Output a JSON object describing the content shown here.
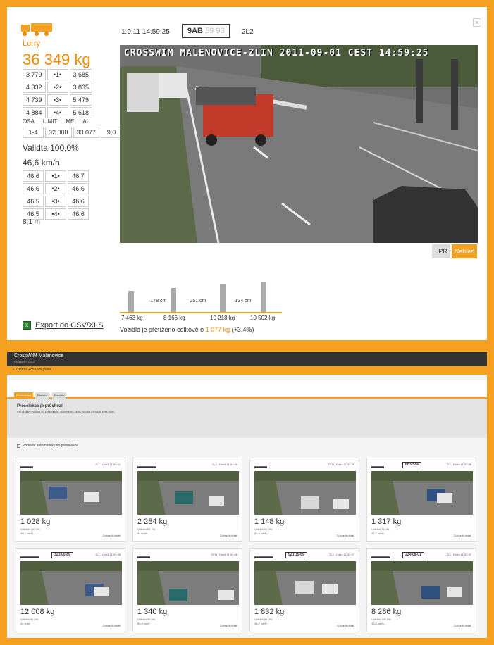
{
  "top": {
    "vehicle_label": "Lorry",
    "total_weight": "36 349 kg",
    "axle_weights": [
      {
        "left": "3 779",
        "axle": "•1•",
        "right": "3 685"
      },
      {
        "left": "4 332",
        "axle": "•2•",
        "right": "3 835"
      },
      {
        "left": "4 739",
        "axle": "•3•",
        "right": "5 479"
      },
      {
        "left": "4 884",
        "axle": "•4•",
        "right": "5 618"
      }
    ],
    "limit_headers": [
      "OSA",
      "LIMIT",
      "ME",
      "AL"
    ],
    "limit_row": [
      "1-4",
      "32 000",
      "33 077",
      "9,0"
    ],
    "validity": "Validta 100,0%",
    "speed": "46,6 km/h",
    "axle_speeds": [
      {
        "left": "46,6",
        "axle": "•1•",
        "right": "46,7"
      },
      {
        "left": "46,6",
        "axle": "•2•",
        "right": "46,6"
      },
      {
        "left": "46,5",
        "axle": "•3•",
        "right": "46,6"
      },
      {
        "left": "46,5",
        "axle": "•4•",
        "right": "46,6"
      }
    ],
    "length": "8,1 m",
    "export_label": "Export do CSV/XLS",
    "timestamp": "1.9.11 14:59:25",
    "plate_visible": "9AB",
    "plate_blurred": "59 93",
    "lane": "2L2",
    "close_label": "×",
    "camera_overlay": "CROSSWIM MALENOVICE-ZLIN   2011-09-01 CEST 14:59:25",
    "btn_lpr": "LPR",
    "btn_nahled": "Náhled",
    "axle_gaps": [
      "178 cm",
      "251 cm",
      "134 cm"
    ],
    "group_weights": [
      "7 463 kg",
      "8 166 kg",
      "10 218 kg",
      "10 502 kg"
    ],
    "bar_levels": [
      0.6,
      0.68,
      0.8,
      0.86
    ],
    "overload_prefix": "Vozidlo je přetíženo celkově o",
    "overload_value": "1 077 kg",
    "overload_pct": "(+3,4%)"
  },
  "bottom": {
    "app_title": "CrossWIM Malenovice",
    "app_subtitle": "CrossWIM 1.0.0",
    "back_label": "« Zpět na kontrolní panel",
    "tabs": [
      "Presedekce",
      "Přehled",
      "Pravidla"
    ],
    "info_title": "Preselekce je průchozí",
    "info_text": "Pro přidání vozidla do preselekce, klikněte na kartu vozidla (dvojklik přes níže).",
    "auto_checkbox": "Přidávat automaticky do preselekce",
    "detail_label": "Zobrazit detail",
    "cards": [
      {
        "icon": "▬▬",
        "plate": "",
        "meta": "2L1 | Dnes 11:04:41",
        "weight": "1 028 kg",
        "validity": "Validita 100,0%",
        "speed": "46,7 km/h"
      },
      {
        "icon": "▬▬▬",
        "plate": "",
        "meta": "2L1 | Dnes 11:04:39",
        "weight": "2 284 kg",
        "validity": "Validita 92,7%",
        "speed": "44 km/h"
      },
      {
        "icon": "▬▬",
        "plate": "",
        "meta": "OTH | Dnes 11:04:38",
        "weight": "1 148 kg",
        "validity": "Validita 91,0%",
        "speed": "53,4 km/h"
      },
      {
        "icon": "▬▬",
        "plate": "6B5/584",
        "meta": "2L1 | Dnes 11:04:38",
        "weight": "1 317 kg",
        "validity": "Validita 75,0%",
        "speed": "48,2 km/h"
      },
      {
        "icon": "▬▬▬",
        "plate": "3Z3 00-89",
        "meta": "2L1 | Dnes 11:04:38",
        "weight": "12 008 kg",
        "validity": "Validita 86,0%",
        "speed": "44 km/h"
      },
      {
        "icon": "▬▬",
        "plate": "",
        "meta": "OTH | Dnes 11:04:38",
        "weight": "1 340 kg",
        "validity": "Validita 95,0%",
        "speed": "50,9 km/h"
      },
      {
        "icon": "▬▬▬",
        "plate": "5Z1 30-69",
        "meta": "2L1 | Dnes 11:04:37",
        "weight": "1 832 kg",
        "validity": "Validita 94,0%",
        "speed": "46,2 km/h"
      },
      {
        "icon": "▬▬▬",
        "plate": "2Z4 08-01",
        "meta": "2L1 | Dnes 11:04:37",
        "weight": "8 286 kg",
        "validity": "Validita 100,0%",
        "speed": "43,8 km/h"
      }
    ]
  },
  "colors": {
    "accent": "#f5a020",
    "accent_text": "#f08a00",
    "dark": "#333333"
  }
}
